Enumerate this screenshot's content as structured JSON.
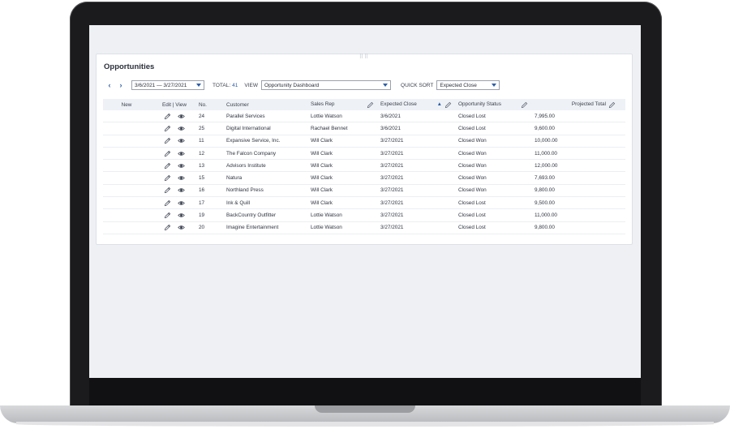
{
  "card": {
    "title": "Opportunities",
    "drag_handle": "⠿⠿"
  },
  "filters": {
    "prev_icon": "chevron-left",
    "next_icon": "chevron-right",
    "date_range": "3/6/2021 — 3/27/2021",
    "total_label": "TOTAL:",
    "total_value": "41",
    "view_label": "VIEW",
    "view_value": "Opportunity Dashboard",
    "quick_sort_label": "QUICK SORT",
    "quick_sort_value": "Expected Close"
  },
  "table": {
    "headers": {
      "new": "New",
      "edit_view": "Edit | View",
      "no": "No.",
      "customer": "Customer",
      "sales_rep": "Sales Rep",
      "expected_close": "Expected Close",
      "status": "Opportunity Status",
      "projected_total": "Projected Total"
    },
    "rows": [
      {
        "no": "24",
        "customer": "Parallel Services",
        "rep": "Lottie Watson",
        "close": "3/6/2021",
        "status": "Closed Lost",
        "total": "7,995.00"
      },
      {
        "no": "25",
        "customer": "Digital International",
        "rep": "Rachael Bennet",
        "close": "3/6/2021",
        "status": "Closed Lost",
        "total": "9,600.00"
      },
      {
        "no": "11",
        "customer": "Expansive Service, Inc.",
        "rep": "Will Clark",
        "close": "3/27/2021",
        "status": "Closed Won",
        "total": "10,000.00"
      },
      {
        "no": "12",
        "customer": "The Falcon Company",
        "rep": "Will Clark",
        "close": "3/27/2021",
        "status": "Closed Won",
        "total": "11,000.00"
      },
      {
        "no": "13",
        "customer": "Advisors Institute",
        "rep": "Will Clark",
        "close": "3/27/2021",
        "status": "Closed Won",
        "total": "12,000.00"
      },
      {
        "no": "15",
        "customer": "Natura",
        "rep": "Will Clark",
        "close": "3/27/2021",
        "status": "Closed Won",
        "total": "7,693.00"
      },
      {
        "no": "16",
        "customer": "Northland Press",
        "rep": "Will Clark",
        "close": "3/27/2021",
        "status": "Closed Won",
        "total": "9,800.00"
      },
      {
        "no": "17",
        "customer": "Ink & Quill",
        "rep": "Will Clark",
        "close": "3/27/2021",
        "status": "Closed Lost",
        "total": "9,500.00"
      },
      {
        "no": "19",
        "customer": "BackCountry Outfitter",
        "rep": "Lottie Watson",
        "close": "3/27/2021",
        "status": "Closed Lost",
        "total": "11,000.00"
      },
      {
        "no": "20",
        "customer": "Imagine Entertainment",
        "rep": "Lottie Watson",
        "close": "3/27/2021",
        "status": "Closed Lost",
        "total": "9,800.00"
      }
    ]
  },
  "colors": {
    "accent": "#2d5ea8",
    "header_bg": "#eef1f6",
    "screen_bg": "#eef0f4"
  }
}
